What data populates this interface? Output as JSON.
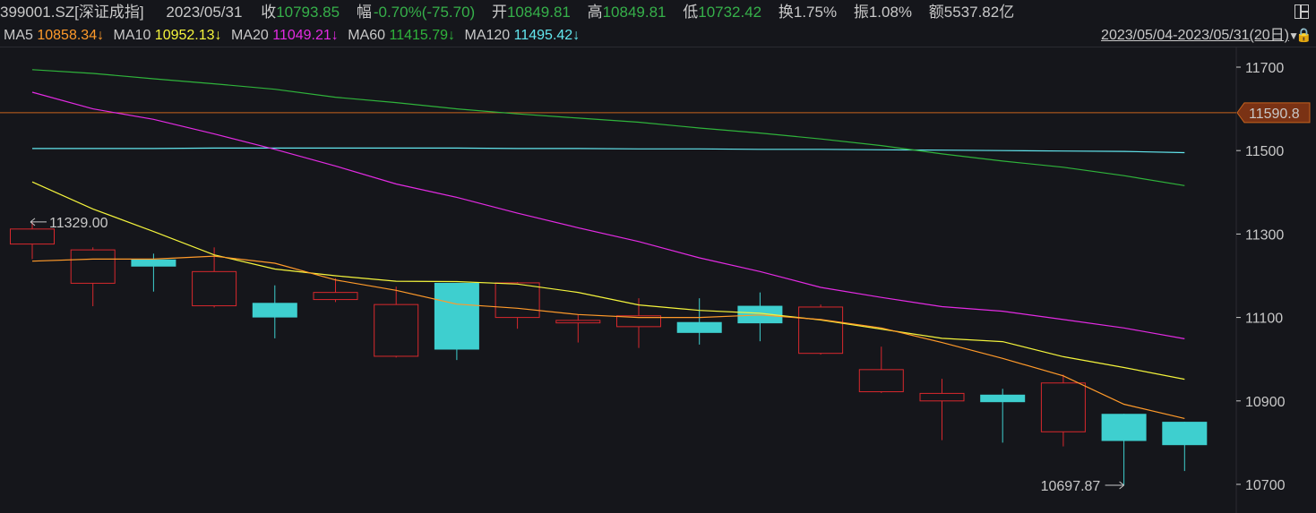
{
  "header": {
    "code": "399001.SZ[深证成指]",
    "date": "2023/05/31",
    "close_label": "收",
    "close_value": "10793.85",
    "change_label": "幅",
    "change_value": "-0.70%(-75.70)",
    "open_label": "开",
    "open_value": "10849.81",
    "high_label": "高",
    "high_value": "10849.81",
    "low_label": "低",
    "low_value": "10732.42",
    "turnover_label": "换",
    "turnover_value": "1.75%",
    "amplitude_label": "振",
    "amplitude_value": "1.08%",
    "amount_label": "额",
    "amount_value": "5537.82亿",
    "layout_icon": "layout-icon"
  },
  "ma_bar": {
    "ma5_label": "MA5",
    "ma5_value": "10858.34↓",
    "ma10_label": "MA10",
    "ma10_value": "10952.13↓",
    "ma20_label": "MA20",
    "ma20_value": "11049.21↓",
    "ma60_label": "MA60",
    "ma60_value": "11415.79↓",
    "ma120_label": "MA120",
    "ma120_value": "11495.42↓",
    "range_text": "2023/05/04-2023/05/31(20日)",
    "lock_icon": "lock-icon",
    "dropdown_icon": "triangle-down-icon"
  },
  "colors": {
    "up": "#d8282d",
    "down": "#3ecfcf",
    "ma5": "#ff9a2a",
    "ma10": "#f4f43c",
    "ma20": "#e32be3",
    "ma60": "#2fb33b",
    "ma120": "#62e6ee",
    "hline": "#c8641e",
    "background": "#15161b"
  },
  "chart_data": {
    "type": "candlestick",
    "ylim": [
      10650,
      11760
    ],
    "yticks": [
      "11700",
      "11500",
      "11300",
      "11100",
      "10900",
      "10700"
    ],
    "price_line": {
      "value": 11590.8,
      "label": "11590.8"
    },
    "high_marker": {
      "label": "11329.00",
      "value": 11329.0,
      "index": 0
    },
    "low_marker": {
      "label": "10697.87",
      "value": 10697.87,
      "index": 18
    },
    "candles": [
      {
        "open": 11276,
        "close": 11312,
        "high": 11329,
        "low": 11240
      },
      {
        "open": 11182,
        "close": 11262,
        "high": 11268,
        "low": 11127
      },
      {
        "open": 11239,
        "close": 11222,
        "high": 11253,
        "low": 11162
      },
      {
        "open": 11128,
        "close": 11210,
        "high": 11268,
        "low": 11124
      },
      {
        "open": 11135,
        "close": 11100,
        "high": 11177,
        "low": 11050
      },
      {
        "open": 11143,
        "close": 11160,
        "high": 11194,
        "low": 11137
      },
      {
        "open": 11007,
        "close": 11131,
        "high": 11174,
        "low": 11004
      },
      {
        "open": 11183,
        "close": 11023,
        "high": 11183,
        "low": 10998
      },
      {
        "open": 11100,
        "close": 11183,
        "high": 11185,
        "low": 11073
      },
      {
        "open": 11087,
        "close": 11093,
        "high": 11107,
        "low": 11040
      },
      {
        "open": 11078,
        "close": 11104,
        "high": 11146,
        "low": 11027
      },
      {
        "open": 11089,
        "close": 11063,
        "high": 11146,
        "low": 11035
      },
      {
        "open": 11128,
        "close": 11086,
        "high": 11160,
        "low": 11043
      },
      {
        "open": 11014,
        "close": 11125,
        "high": 11131,
        "low": 11011
      },
      {
        "open": 10922,
        "close": 10975,
        "high": 11030,
        "low": 10919
      },
      {
        "open": 10900,
        "close": 10918,
        "high": 10953,
        "low": 10806
      },
      {
        "open": 10915,
        "close": 10897,
        "high": 10929,
        "low": 10800
      },
      {
        "open": 10826,
        "close": 10943,
        "high": 10963,
        "low": 10791
      },
      {
        "open": 10869,
        "close": 10804,
        "high": 10869,
        "low": 10698
      },
      {
        "open": 10850,
        "close": 10794,
        "high": 10850,
        "low": 10732
      }
    ],
    "ma5": [
      11235,
      11240,
      11240,
      11247,
      11230,
      11190,
      11165,
      11132,
      11122,
      11107,
      11100,
      11100,
      11106,
      11095,
      11075,
      11040,
      11002,
      10960,
      10892,
      10858
    ],
    "ma10": [
      11425,
      11360,
      11306,
      11250,
      11216,
      11200,
      11187,
      11186,
      11180,
      11160,
      11130,
      11117,
      11110,
      11094,
      11072,
      11050,
      11042,
      11006,
      10980,
      10952
    ],
    "ma20": [
      11640,
      11600,
      11575,
      11540,
      11503,
      11463,
      11420,
      11388,
      11350,
      11315,
      11282,
      11243,
      11210,
      11172,
      11148,
      11126,
      11115,
      11095,
      11075,
      11049
    ],
    "ma60": [
      11694,
      11685,
      11672,
      11660,
      11647,
      11628,
      11615,
      11600,
      11588,
      11578,
      11568,
      11554,
      11542,
      11528,
      11512,
      11492,
      11475,
      11460,
      11440,
      11416
    ],
    "ma120": [
      11505,
      11505,
      11505,
      11506,
      11506,
      11506,
      11506,
      11506,
      11505,
      11505,
      11504,
      11504,
      11503,
      11503,
      11502,
      11501,
      11500,
      11499,
      11498,
      11495
    ]
  }
}
